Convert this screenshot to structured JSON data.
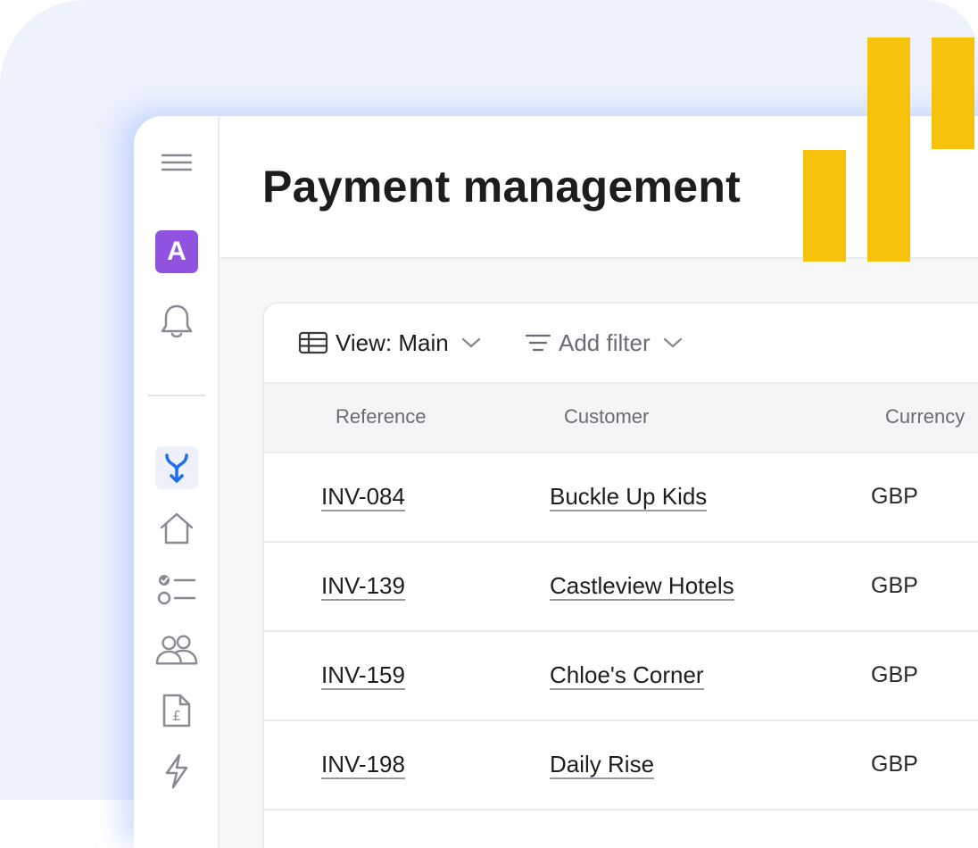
{
  "header": {
    "title": "Payment management"
  },
  "sidebar": {
    "avatar_initial": "A",
    "icons": [
      "menu-icon",
      "bell-icon",
      "merge-icon",
      "home-icon",
      "checklist-icon",
      "users-icon",
      "pound-document-icon",
      "lightning-icon"
    ]
  },
  "toolbar": {
    "view_label": "View: Main",
    "filter_label": "Add filter"
  },
  "table": {
    "columns": [
      "Reference",
      "Customer",
      "Currency"
    ],
    "rows": [
      {
        "reference": "INV-084",
        "customer": "Buckle Up Kids",
        "currency": "GBP"
      },
      {
        "reference": "INV-139",
        "customer": "Castleview Hotels",
        "currency": "GBP"
      },
      {
        "reference": "INV-159",
        "customer": "Chloe's Corner",
        "currency": "GBP"
      },
      {
        "reference": "INV-198",
        "customer": "Daily Rise",
        "currency": "GBP"
      }
    ]
  },
  "colors": {
    "accent_yellow": "#f7c20c",
    "avatar_purple": "#9152e0",
    "active_blue": "#1e6ff0",
    "background_tint": "#edf2fd"
  }
}
